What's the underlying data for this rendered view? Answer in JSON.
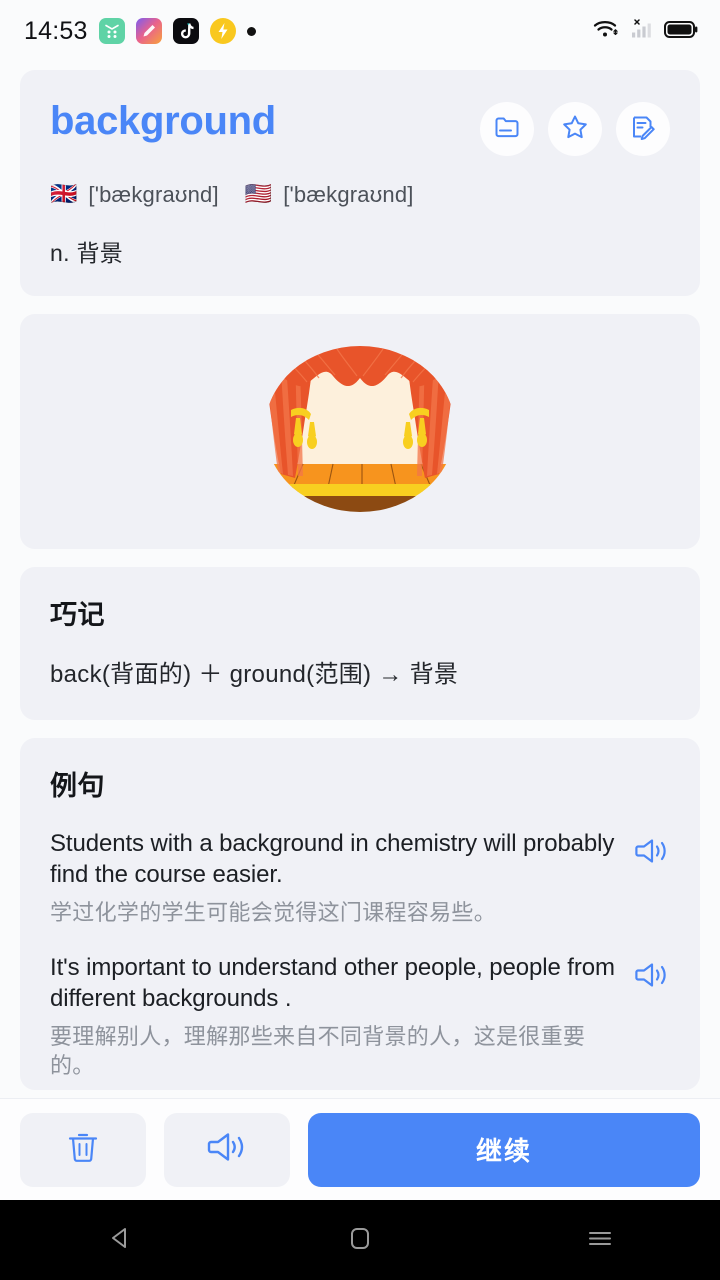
{
  "statusbar": {
    "time": "14:53",
    "app_icons": [
      {
        "name": "green-app-icon"
      },
      {
        "name": "gradient-app-icon"
      },
      {
        "name": "tiktok-app-icon"
      },
      {
        "name": "lightning-app-icon"
      },
      {
        "name": "dot-indicator"
      }
    ],
    "right_icons": [
      "wifi-icon",
      "cellular-signal-no-sim-icon",
      "battery-icon"
    ]
  },
  "header": {
    "word": "background",
    "actions": [
      {
        "name": "folder-button",
        "icon": "folder-icon"
      },
      {
        "name": "favorite-button",
        "icon": "star-icon"
      },
      {
        "name": "note-button",
        "icon": "note-edit-icon"
      }
    ],
    "uk_flag": "🇬🇧",
    "uk_phonetic": "['bækgraʊnd]",
    "us_flag": "🇺🇸",
    "us_phonetic": "['bækgraʊnd]",
    "definition": "n. 背景"
  },
  "illustration": {
    "name": "theater-stage-illustration",
    "alt": "theater stage with red curtains"
  },
  "mnemonic": {
    "title": "巧记",
    "text": "back(背面的) ＋ ground(范围) → 背景"
  },
  "examples": {
    "title": "例句",
    "items": [
      {
        "en": "Students with a background in chemistry will probably find the course easier.",
        "zh": "学过化学的学生可能会觉得这门课程容易些。",
        "speaker_icon": "speaker-icon"
      },
      {
        "en": "It's important to understand other people, people from different backgrounds .",
        "zh": "要理解别人，理解那些来自不同背景的人，这是很重要的。",
        "speaker_icon": "speaker-icon"
      }
    ]
  },
  "bottombar": {
    "delete_icon": "trash-icon",
    "speak_icon": "speaker-icon",
    "continue_label": "继续"
  },
  "navbar": {
    "back": "back-triangle-icon",
    "home": "home-square-icon",
    "recents": "recents-menu-icon"
  },
  "colors": {
    "accent": "#4a86f7",
    "page_bg": "#fafbfc",
    "card_bg": "#f0f1f6",
    "text_primary": "#23262b",
    "text_muted": "#8e939c"
  }
}
